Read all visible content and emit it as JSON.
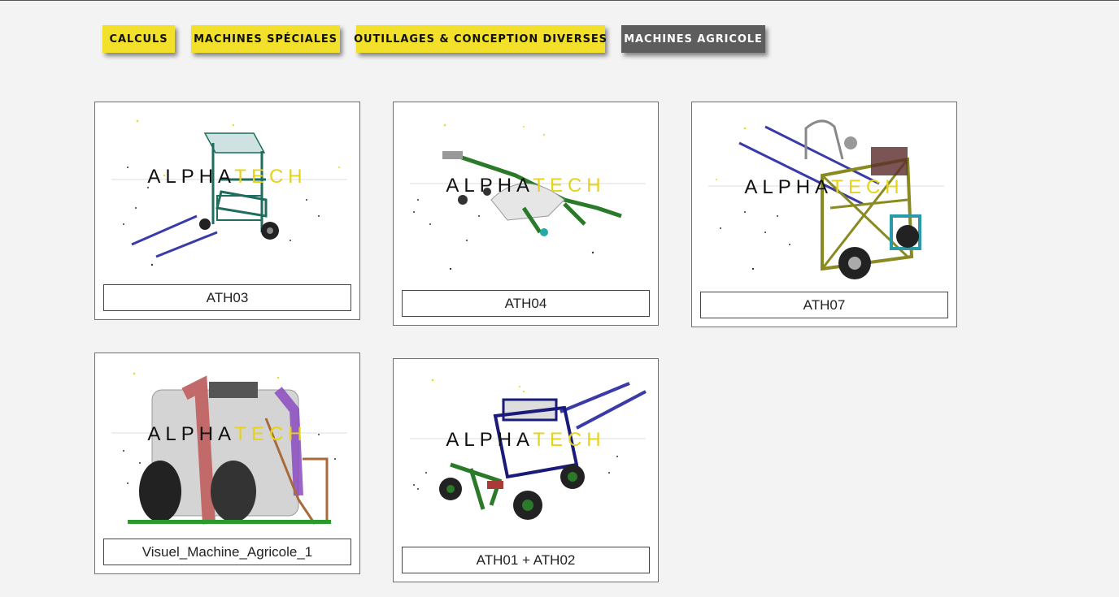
{
  "tabs": [
    {
      "label": "CALCULS",
      "active": false
    },
    {
      "label": "MACHINES SPÉCIALES",
      "active": false
    },
    {
      "label": "OUTILLAGES & CONCEPTION DIVERSES",
      "active": false
    },
    {
      "label": "MACHINES AGRICOLE",
      "active": true
    }
  ],
  "colors": {
    "tab_yellow": "#f2e02a",
    "tab_active": "#5d5d5d",
    "page_background": "#f3f3f3",
    "watermark_dark": "#111111",
    "watermark_yellow": "#e6d21a"
  },
  "watermark": {
    "part1": "ALPHA",
    "part2": "TECH"
  },
  "gallery": [
    {
      "caption": "ATH03",
      "image": "machine-ath03-image"
    },
    {
      "caption": "ATH04",
      "image": "machine-ath04-image"
    },
    {
      "caption": "ATH07",
      "image": "machine-ath07-image"
    },
    {
      "caption": "Visuel_Machine_Agricole_1",
      "image": "machine-visuel-1-image"
    },
    {
      "caption": "ATH01 + ATH02",
      "image": "machine-ath01-ath02-image"
    }
  ]
}
